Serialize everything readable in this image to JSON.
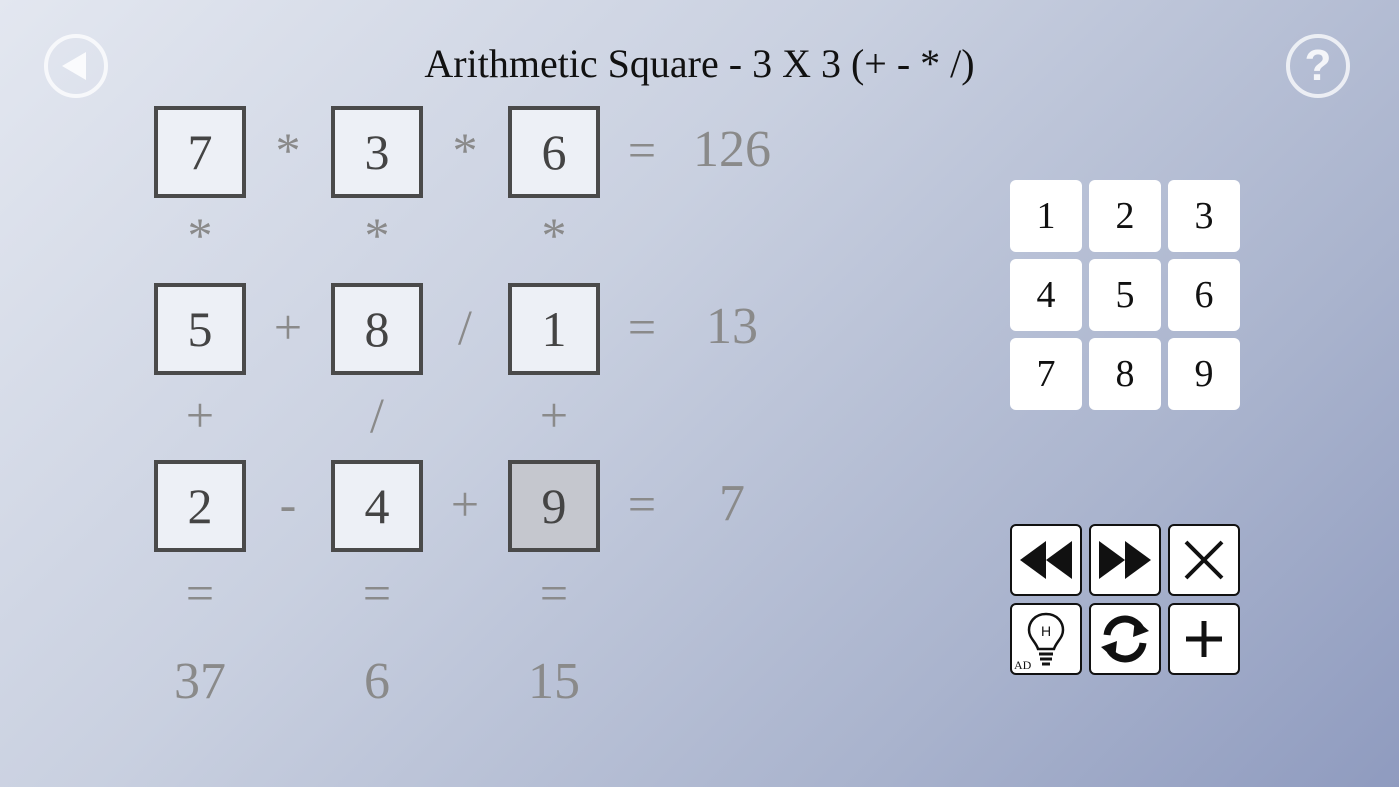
{
  "title": "Arithmetic Square - 3 X 3 (+ - * /)",
  "grid": {
    "cells": [
      [
        "7",
        "3",
        "6"
      ],
      [
        "5",
        "8",
        "1"
      ],
      [
        "2",
        "4",
        "9"
      ]
    ],
    "row_ops": [
      [
        "*",
        "*"
      ],
      [
        "+",
        "/"
      ],
      [
        "-",
        "+"
      ]
    ],
    "col_ops": [
      [
        "*",
        "*",
        "*"
      ],
      [
        "+",
        "/",
        "+"
      ]
    ],
    "row_results": [
      "126",
      "13",
      "7"
    ],
    "col_results": [
      "37",
      "6",
      "15"
    ],
    "equals": "=",
    "selected_cell": "9"
  },
  "keypad": {
    "keys": [
      "1",
      "2",
      "3",
      "4",
      "5",
      "6",
      "7",
      "8",
      "9"
    ]
  },
  "controls": {
    "hint_ad_label": "AD",
    "hint_letter": "H"
  },
  "icons": {
    "back": "back-arrow-icon",
    "help": "question-mark-icon",
    "help_glyph": "?"
  }
}
